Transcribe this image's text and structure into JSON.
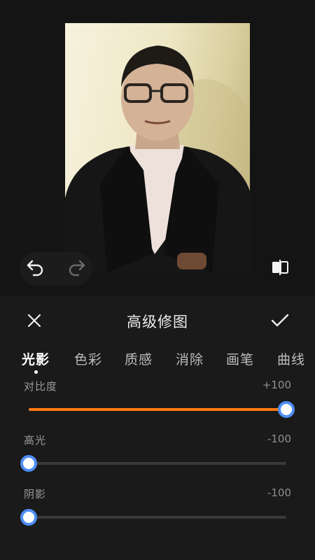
{
  "editor": {
    "title": "高级修图"
  },
  "tabs": [
    {
      "label": "光影",
      "active": true
    },
    {
      "label": "色彩",
      "active": false
    },
    {
      "label": "质感",
      "active": false
    },
    {
      "label": "消除",
      "active": false
    },
    {
      "label": "画笔",
      "active": false
    },
    {
      "label": "曲线",
      "active": false
    }
  ],
  "sliders": [
    {
      "label": "对比度",
      "value_text": "+100",
      "value": 100,
      "min": -100,
      "max": 100,
      "fill_color": "#ff7a12"
    },
    {
      "label": "高光",
      "value_text": "-100",
      "value": -100,
      "min": -100,
      "max": 100
    },
    {
      "label": "阴影",
      "value_text": "-100",
      "value": -100,
      "min": -100,
      "max": 100
    }
  ],
  "icons": {
    "undo": "undo-arrow-icon",
    "redo": "redo-arrow-icon",
    "compare": "compare-split-icon",
    "close": "close-x-icon",
    "confirm": "checkmark-icon"
  },
  "colors": {
    "accent": "#ff7a12",
    "knob_ring": "#4f8ef5",
    "panel_bg": "#1a1a1a"
  }
}
